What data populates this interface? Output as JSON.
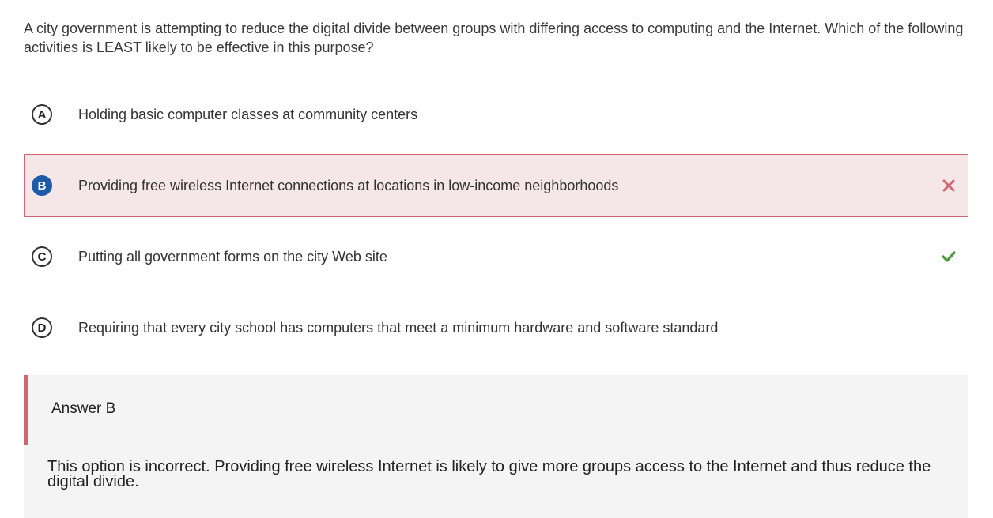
{
  "question": "A city government is attempting to reduce the digital divide between groups with differing access to computing and the Internet. Which of the following activities is LEAST likely to be effective in this purpose?",
  "options": [
    {
      "letter": "A",
      "text": "Holding basic computer classes at community centers",
      "state": "none"
    },
    {
      "letter": "B",
      "text": "Providing free wireless Internet connections at locations in low-income neighborhoods",
      "state": "selected-incorrect",
      "mark_icon": "x-icon"
    },
    {
      "letter": "C",
      "text": "Putting all government forms on the city Web site",
      "state": "correct",
      "mark_icon": "check-icon"
    },
    {
      "letter": "D",
      "text": "Requiring that every city school has computers that meet a minimum hardware and software standard",
      "state": "none"
    }
  ],
  "feedback": {
    "title": "Answer B",
    "explanation": "This option is incorrect. Providing free wireless Internet is likely to give more groups access to the Internet and thus reduce the digital divide."
  },
  "colors": {
    "selected_badge": "#1f5aa8",
    "incorrect": "#d06470",
    "incorrect_bg": "#f5e7e8",
    "correct": "#4a9a3d",
    "feedback_bg": "#f4f4f4"
  }
}
